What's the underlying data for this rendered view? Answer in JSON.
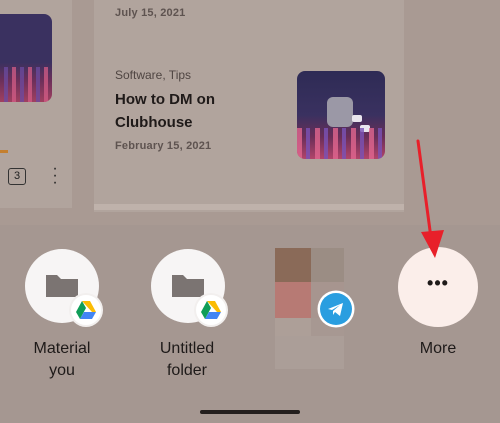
{
  "background_app": {
    "left_card": {
      "count": "3"
    },
    "article": {
      "date_top": "July 15, 2021",
      "category": "Software, Tips",
      "title": "How to DM on Clubhouse",
      "date": "February 15, 2021"
    }
  },
  "share_targets": [
    {
      "label": "Material\nyou",
      "icon": "folder-icon",
      "badge": "google-drive-icon"
    },
    {
      "label": "Untitled\nfolder",
      "icon": "folder-icon",
      "badge": "google-drive-icon"
    },
    {
      "label": "",
      "icon": "contact-thumbnail",
      "badge": "telegram-icon"
    },
    {
      "label": "More",
      "icon": "more-horiz-icon"
    }
  ],
  "colors": {
    "scrim": "#a59791",
    "arrow": "#e8202a",
    "telegram": "#2a9ee0",
    "more_button": "#fbeeea"
  }
}
